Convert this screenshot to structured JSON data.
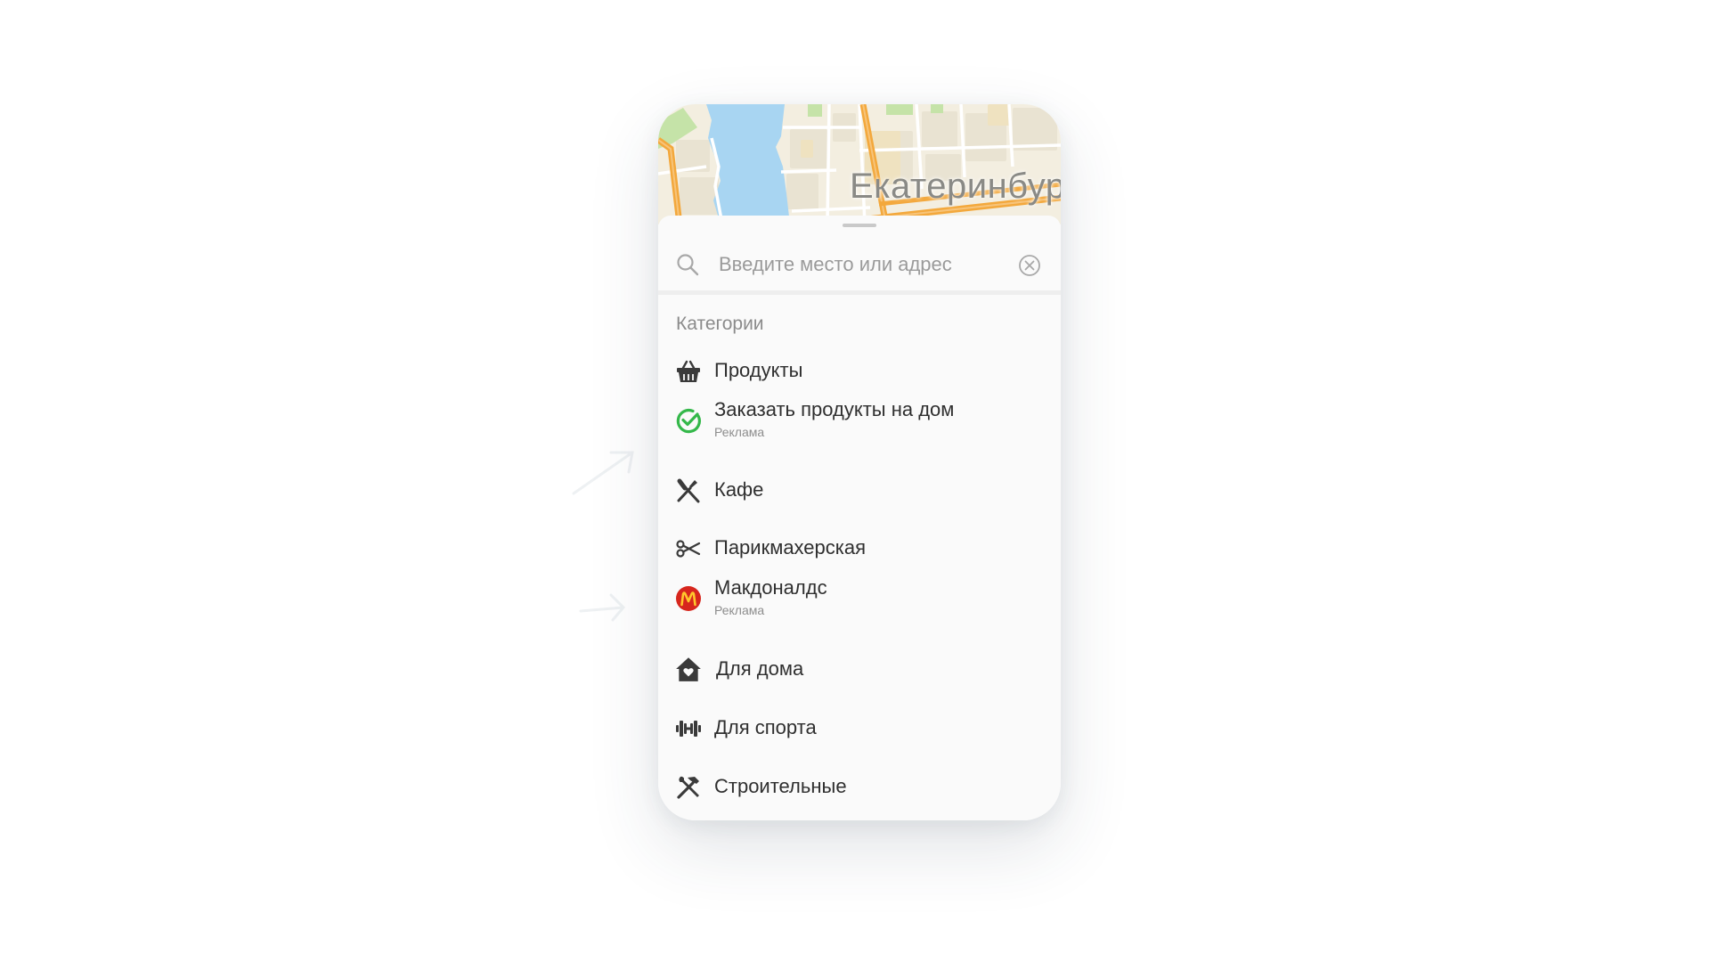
{
  "map": {
    "city_label": "Екатеринбург"
  },
  "search": {
    "placeholder": "Введите место или адрес",
    "icon": "search-icon",
    "clear_icon": "clear-circle-icon"
  },
  "categories": {
    "title": "Категории",
    "items": [
      {
        "label": "Продукты",
        "icon": "basket-icon"
      },
      {
        "label": "Заказать продукты на дом",
        "sublabel": "Реклама",
        "icon": "check-circle-icon",
        "icon_color": "#34b84a"
      },
      {
        "label": "Кафе",
        "icon": "fork-knife-icon"
      },
      {
        "label": "Парикмахерская",
        "icon": "scissors-icon"
      },
      {
        "label": "Макдоналдс",
        "sublabel": "Реклама",
        "icon": "mcdonalds-logo-icon",
        "icon_color": "#d7261d"
      },
      {
        "label": "Для дома",
        "icon": "house-heart-icon"
      },
      {
        "label": "Для спорта",
        "icon": "dumbbell-icon"
      },
      {
        "label": "Строительные",
        "icon": "hammer-wrench-icon"
      }
    ]
  },
  "colors": {
    "map_water": "#a8d5f2",
    "map_land": "#f3eee0",
    "map_road_major": "#f3a83c",
    "map_park": "#c5e3a8",
    "text_primary": "#2f2f2f",
    "text_secondary": "#8b8b8b"
  }
}
